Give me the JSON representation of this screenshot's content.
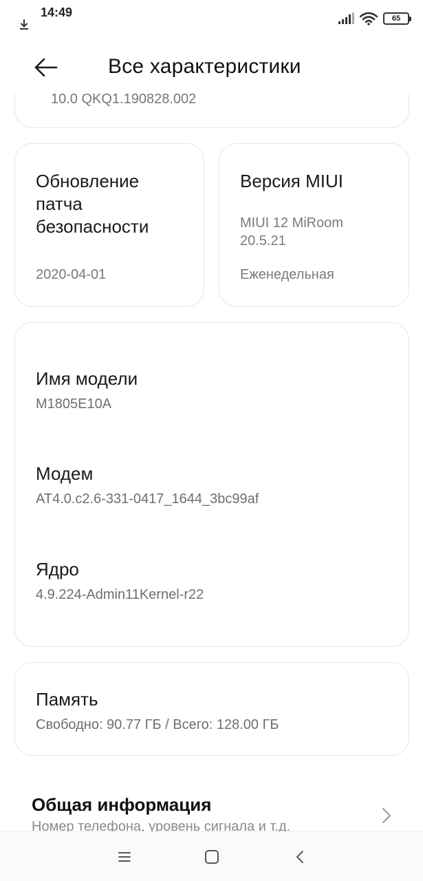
{
  "status_bar": {
    "time": "14:49",
    "battery": "65",
    "icons": [
      "download-icon",
      "signal-icon",
      "wifi-icon",
      "battery-icon"
    ]
  },
  "header": {
    "title": "Все характеристики",
    "back_icon": "arrow-left-icon"
  },
  "top_card": {
    "partial_text": "10.0 QKQ1.190828.002"
  },
  "security_card": {
    "title": "Обновление патча безопасности",
    "title_lines": [
      "Обновление",
      "патча",
      "безопасности"
    ],
    "value": "2020-04-01"
  },
  "miui_card": {
    "title": "Версия MIUI",
    "version_lines": [
      "MIUI 12 MiRoom",
      "20.5.21"
    ],
    "channel": "Еженедельная"
  },
  "device_card": {
    "rows": [
      {
        "title": "Имя модели",
        "value": "M1805E10A"
      },
      {
        "title": "Модем",
        "value": "AT4.0.c2.6-331-0417_1644_3bc99af"
      },
      {
        "title": "Ядро",
        "value": "4.9.224-Admin11Kernel-r22"
      }
    ]
  },
  "memory_card": {
    "title": "Память",
    "value": "Свободно: 90.77 ГБ / Всего: 128.00 ГБ"
  },
  "general_info": {
    "title": "Общая информация",
    "subtitle": "Номер телефона, уровень сигнала и т.д."
  },
  "nav_bar": {
    "buttons": [
      "menu-icon",
      "home-icon",
      "back-icon"
    ]
  }
}
